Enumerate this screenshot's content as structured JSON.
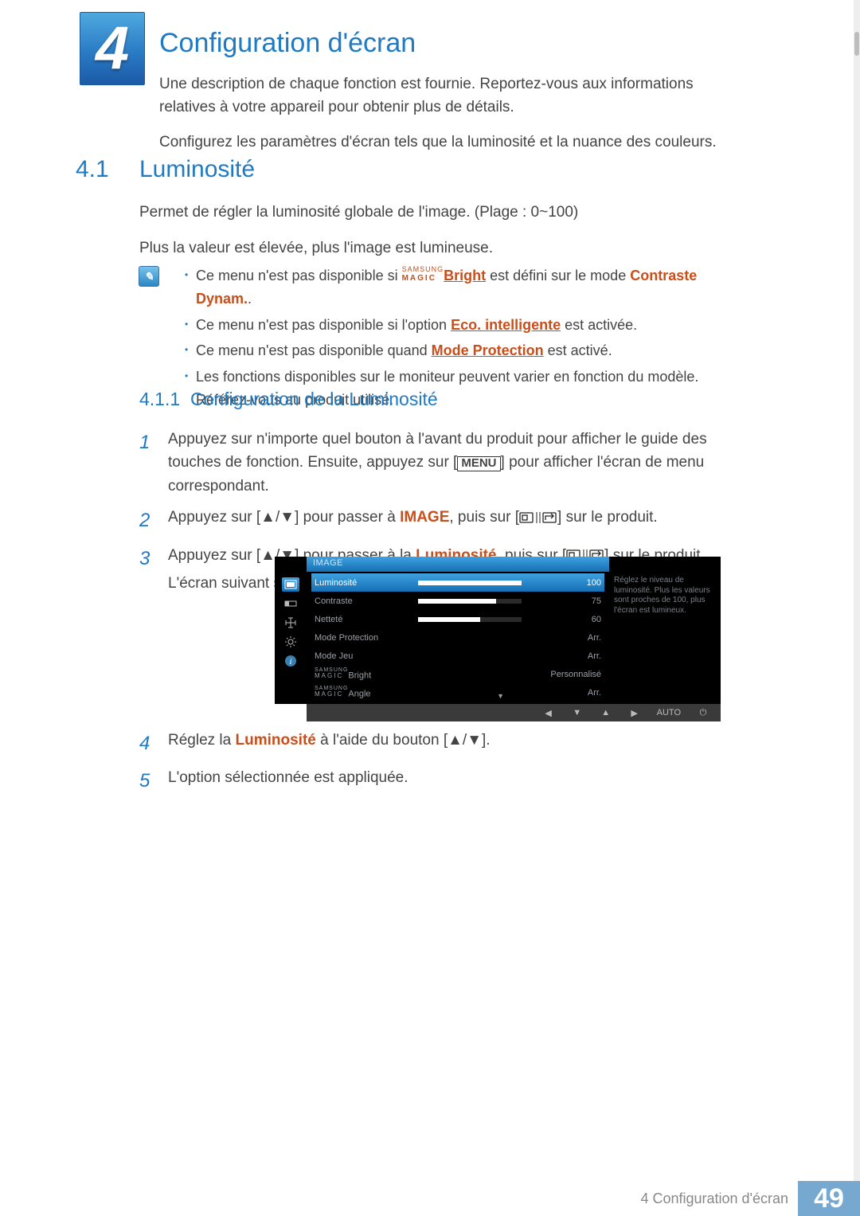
{
  "chapter": {
    "number": "4",
    "title": "Configuration d'écran"
  },
  "intro": {
    "p1": "Une description de chaque fonction est fournie. Reportez-vous aux informations relatives à votre appareil pour obtenir plus de détails.",
    "p2": "Configurez les paramètres d'écran tels que la luminosité et la nuance des couleurs."
  },
  "section41": {
    "number": "4.1",
    "title": "Luminosité",
    "p1": "Permet de régler la luminosité globale de l'image. (Plage : 0~100)",
    "p2": "Plus la valeur est élevée, plus l'image est lumineuse."
  },
  "note": {
    "b1a": "Ce menu n'est pas disponible si ",
    "b1_magic_top": "SAMSUNG",
    "b1_magic_bot": "MAGIC",
    "b1_bright": "Bright",
    "b1b": " est défini sur le mode ",
    "b1_link": "Contraste Dynam.",
    "b1c": ".",
    "b2a": "Ce menu n'est pas disponible si l'option ",
    "b2_link": "Eco. intelligente",
    "b2b": " est activée.",
    "b3a": "Ce menu n'est pas disponible quand ",
    "b3_link": "Mode Protection",
    "b3b": " est activé.",
    "b4": "Les fonctions disponibles sur le moniteur peuvent varier en fonction du modèle. Référez-vous au produit utilisé."
  },
  "sub411": {
    "number": "4.1.1",
    "title": "Configuration de la Luminosité",
    "step1a": "Appuyez sur n'importe quel bouton à l'avant du produit pour afficher le guide des touches de fonction. Ensuite, appuyez sur [",
    "step1_menu": "MENU",
    "step1b": "] pour afficher l'écran de menu correspondant.",
    "step2a": "Appuyez sur [",
    "step2_arrows": "▲/▼",
    "step2b": "] pour passer à ",
    "step2_image": "IMAGE",
    "step2c": ", puis sur [",
    "step2d": "] sur le produit.",
    "step3a": "Appuyez sur [",
    "step3_arrows": "▲/▼",
    "step3b": "] pour passer à la ",
    "step3_lum": "Luminosité",
    "step3c": ", puis sur [",
    "step3d": "] sur le produit.",
    "step3e": "L'écran suivant s'affiche.",
    "step4a": "Réglez la ",
    "step4_lum": "Luminosité",
    "step4b": " à l'aide du bouton [",
    "step4_arrows": "▲/▼",
    "step4c": "].",
    "step5": "L'option sélectionnée est appliquée."
  },
  "osd": {
    "header": "IMAGE",
    "rows": [
      {
        "label": "Luminosité",
        "value": "100",
        "slider": 100,
        "selected": true
      },
      {
        "label": "Contraste",
        "value": "75",
        "slider": 75,
        "selected": false
      },
      {
        "label": "Netteté",
        "value": "60",
        "slider": 60,
        "selected": false
      },
      {
        "label": "Mode Protection",
        "value": "Arr.",
        "slider": null,
        "selected": false
      },
      {
        "label": "Mode Jeu",
        "value": "Arr.",
        "slider": null,
        "selected": false
      },
      {
        "label": "_MAGIC_Bright",
        "value": "Personnalisé",
        "slider": null,
        "selected": false
      },
      {
        "label": "_MAGIC_Angle",
        "value": "Arr.",
        "slider": null,
        "selected": false
      }
    ],
    "magic_top": "SAMSUNG",
    "magic_bot": "MAGIC",
    "magic_bright_suffix": "Bright",
    "magic_angle_suffix": "Angle",
    "side_text": "Réglez le niveau de luminosité. Plus les valeurs sont proches de 100, plus l'écran est lumineux.",
    "nav_auto": "AUTO",
    "scroll_arrow": "▼"
  },
  "footer": {
    "label": "4 Configuration d'écran",
    "page": "49"
  }
}
